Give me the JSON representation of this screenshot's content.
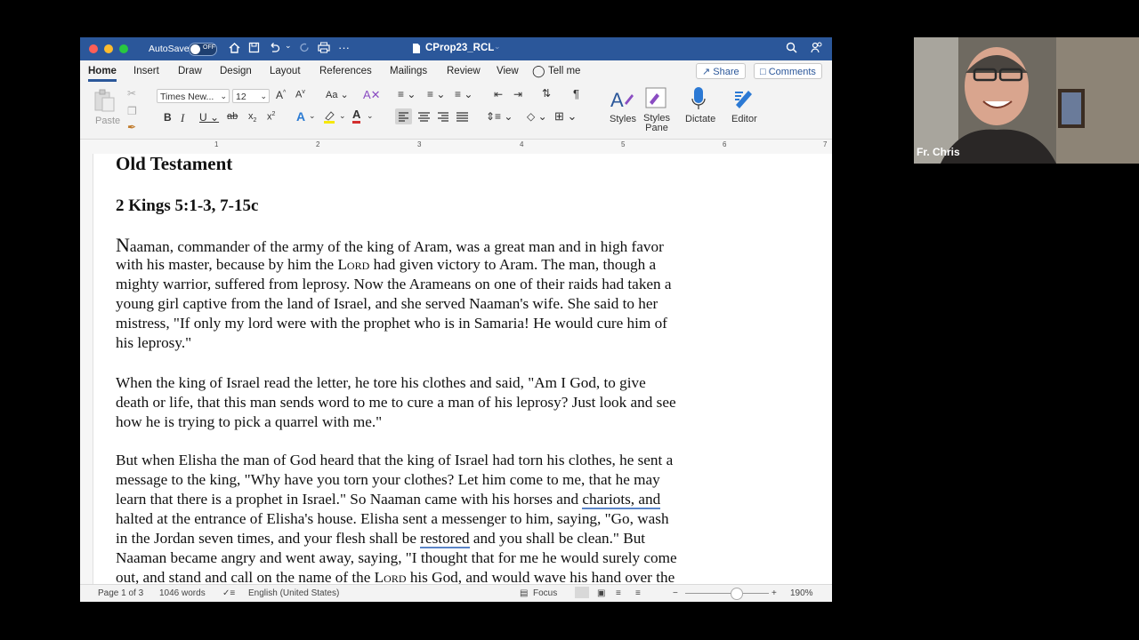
{
  "titlebar": {
    "autosave_label": "AutoSave",
    "autosave_state": "OFF",
    "document_title": "CProp23_RCL",
    "icons": [
      "home-icon",
      "save-icon",
      "undo-icon",
      "redo-icon",
      "print-icon",
      "more-icon",
      "search-icon",
      "share-people-icon"
    ]
  },
  "tabs": [
    "Home",
    "Insert",
    "Draw",
    "Design",
    "Layout",
    "References",
    "Mailings",
    "Review",
    "View"
  ],
  "tell_me": "Tell me",
  "share_label": "Share",
  "comments_label": "Comments",
  "ribbon": {
    "paste_label": "Paste",
    "font_name": "Times New...",
    "font_size": "12",
    "styles_label": "Styles",
    "styles_pane_line1": "Styles",
    "styles_pane_line2": "Pane",
    "dictate_label": "Dictate",
    "editor_label": "Editor"
  },
  "ruler_numbers": [
    "1",
    "2",
    "3",
    "4",
    "5",
    "6",
    "7"
  ],
  "document": {
    "heading": "Old Testament",
    "subheading": "2 Kings 5:1-3, 7-15c",
    "p1": {
      "dropcap": "N",
      "l1": "aaman, commander of the army of the king of Aram, was a great man and in high favor",
      "l2a": "with his master, because by him the ",
      "lord": "Lord",
      "l2b": " had given victory to Aram. The man, though a",
      "l3": "mighty warrior, suffered from leprosy. Now the Arameans on one of their raids had taken a",
      "l4": "young girl captive from the land of Israel, and she served Naaman's wife. She said to her",
      "l5": "mistress, \"If only my lord were with the prophet who is in Samaria! He would cure him of",
      "l6": "his leprosy.\""
    },
    "p2": {
      "l1": "When the king of Israel read the letter, he tore his clothes and said, \"Am I God, to give",
      "l2": "death or life, that this man sends word to me to cure a man of his leprosy? Just look and see",
      "l3": "how he is trying to pick a quarrel with me.\""
    },
    "p3": {
      "l1": "But when Elisha the man of God heard that the king of Israel had torn his clothes, he sent a",
      "l2": "message to the king, \"Why have you torn your clothes? Let him come to me, that he may",
      "l3a": "learn that there is a prophet in Israel.\" So Naaman came with his horses and ",
      "l3u": "chariots, and",
      "l4": "halted at the entrance of Elisha's house. Elisha sent a messenger to him, saying, \"Go, wash",
      "l5a": "in the Jordan seven times, and your flesh shall be ",
      "l5u": "restored",
      "l5b": " and you shall be clean.\" But",
      "l6": "Naaman became angry and went away, saying, \"I thought that for me he would surely come",
      "l7a": "out, and stand and call on the name of the ",
      "l7lord": "Lord",
      "l7b": " his God, and would wave his hand over the"
    }
  },
  "status": {
    "page": "Page 1 of 3",
    "words": "1046 words",
    "language": "English (United States)",
    "focus": "Focus",
    "zoom": "190%"
  },
  "video": {
    "participant_name": "Fr. Chris"
  }
}
